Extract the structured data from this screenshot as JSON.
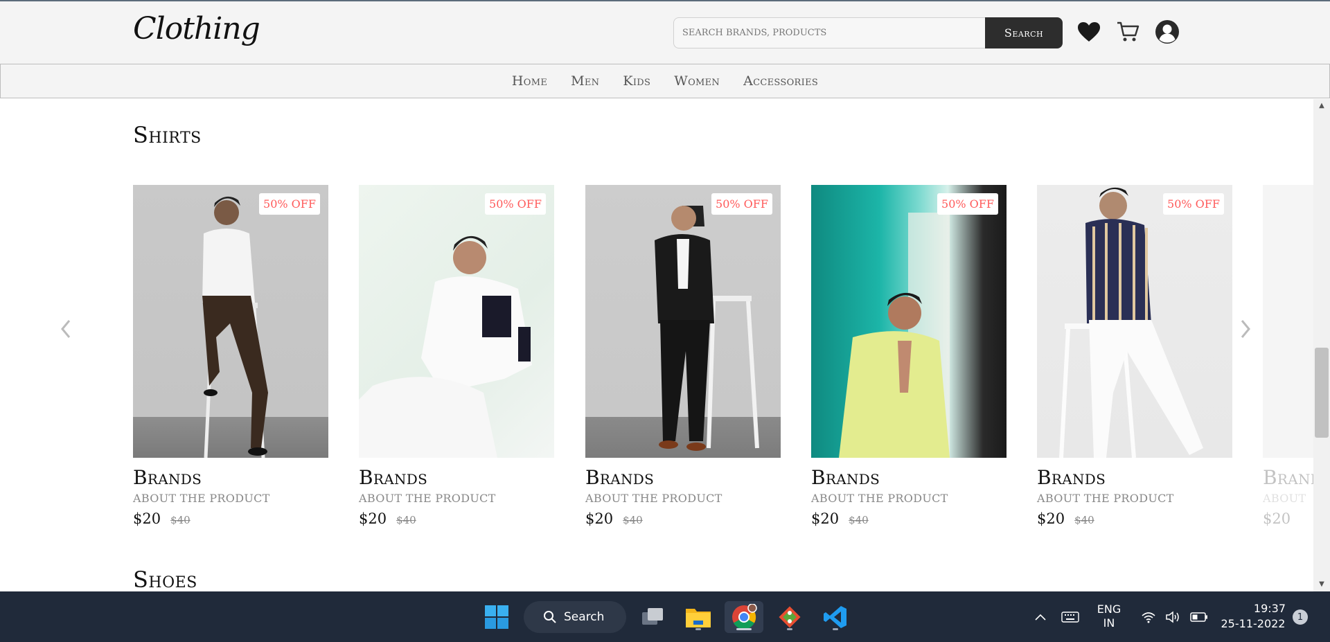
{
  "header": {
    "logo": "Clothing",
    "search_placeholder": "SEARCH BRANDS, PRODUCTS",
    "search_button": "Search"
  },
  "nav": [
    "Home",
    "Men",
    "Kids",
    "Women",
    "Accessories"
  ],
  "sections": {
    "shirts_title": "Shirts",
    "shoes_title": "Shoes"
  },
  "products": [
    {
      "badge": "50% OFF",
      "brand": "Brands",
      "about": "ABOUT THE PRODUCT",
      "price": "$20",
      "old_price": "$40"
    },
    {
      "badge": "50% OFF",
      "brand": "Brands",
      "about": "ABOUT THE PRODUCT",
      "price": "$20",
      "old_price": "$40"
    },
    {
      "badge": "50% OFF",
      "brand": "Brands",
      "about": "ABOUT THE PRODUCT",
      "price": "$20",
      "old_price": "$40"
    },
    {
      "badge": "50% OFF",
      "brand": "Brands",
      "about": "ABOUT THE PRODUCT",
      "price": "$20",
      "old_price": "$40"
    },
    {
      "badge": "50% OFF",
      "brand": "Brands",
      "about": "ABOUT THE PRODUCT",
      "price": "$20",
      "old_price": "$40"
    },
    {
      "badge": "",
      "brand": "Brands",
      "about": "ABOUT",
      "price": "$20",
      "old_price": ""
    }
  ],
  "taskbar": {
    "search_label": "Search",
    "lang_line1": "ENG",
    "lang_line2": "IN",
    "time": "19:37",
    "date": "25-11-2022",
    "notification_count": "1"
  },
  "colors": {
    "accent_dark": "#2d2d2d",
    "badge_text": "#ff5a5a",
    "taskbar_bg": "#202a3a"
  },
  "icons": [
    "heart-icon",
    "cart-icon",
    "user-icon",
    "chevron-left-icon",
    "chevron-right-icon",
    "windows-start-icon",
    "search-icon",
    "task-view-icon",
    "file-explorer-icon",
    "chrome-icon",
    "git-icon",
    "vscode-icon",
    "chevron-up-icon",
    "keyboard-icon",
    "wifi-icon",
    "volume-icon",
    "battery-icon"
  ]
}
